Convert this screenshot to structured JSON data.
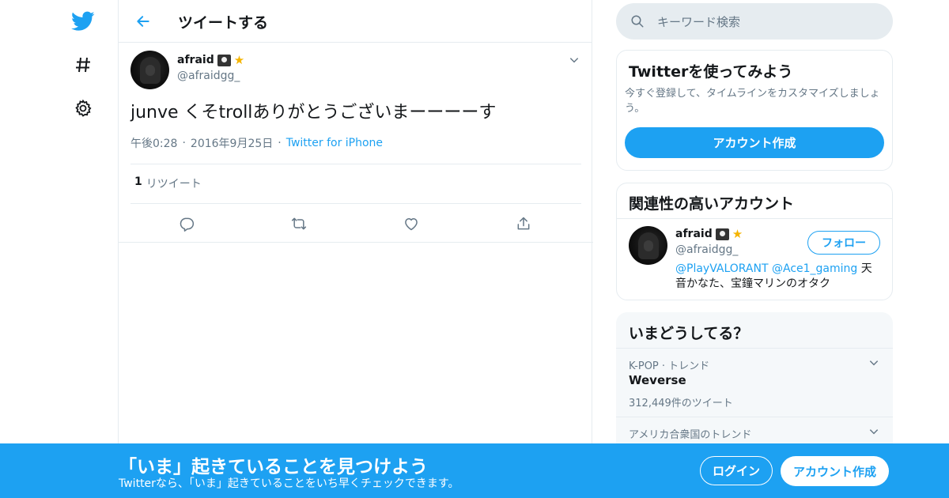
{
  "header": {
    "title": "ツイートする"
  },
  "tweet": {
    "author_name": "afraid",
    "author_handle": "@afraidgg_",
    "text": "junve くそtrollありがとうございまーーーーす",
    "time": "午後0:28",
    "date": "2016年9月25日",
    "source": "Twitter for iPhone",
    "sep": "·",
    "retweet_count": "1",
    "retweet_label": "リツイート"
  },
  "search": {
    "placeholder": "キーワード検索"
  },
  "signup_card": {
    "title": "Twitterを使ってみよう",
    "desc": "今すぐ登録して、タイムラインをカスタマイズしましょう。",
    "button": "アカウント作成"
  },
  "related_card": {
    "title": "関連性の高いアカウント",
    "name": "afraid",
    "handle": "@afraidgg_",
    "follow": "フォロー",
    "mention1": "@PlayVALORANT",
    "mention2": "@Ace1_gaming",
    "bio_rest": " 天音かなた、宝鐘マリンのオタク"
  },
  "trends": {
    "title": "いまどうしてる？",
    "items": [
      {
        "context": "K-POP · トレンド",
        "name": "Weverse",
        "count": "312,449件のツイート"
      },
      {
        "context": "アメリカ合衆国のトレンド",
        "name": "",
        "count": ""
      }
    ]
  },
  "banner": {
    "title": "「いま」起きていることを見つけよう",
    "subtitle": "Twitterなら、「いま」起きていることをいち早くチェックできます。",
    "login": "ログイン",
    "signup": "アカウント作成"
  },
  "colors": {
    "brand": "#1da1f2",
    "text": "#14171a",
    "muted": "#657786",
    "border": "#e6ecf0"
  },
  "icons": [
    "twitter-bird-icon",
    "hashtag-icon",
    "settings-gear-icon",
    "back-arrow-icon",
    "chevron-down-icon",
    "reply-icon",
    "retweet-icon",
    "like-heart-icon",
    "share-icon",
    "search-icon"
  ]
}
